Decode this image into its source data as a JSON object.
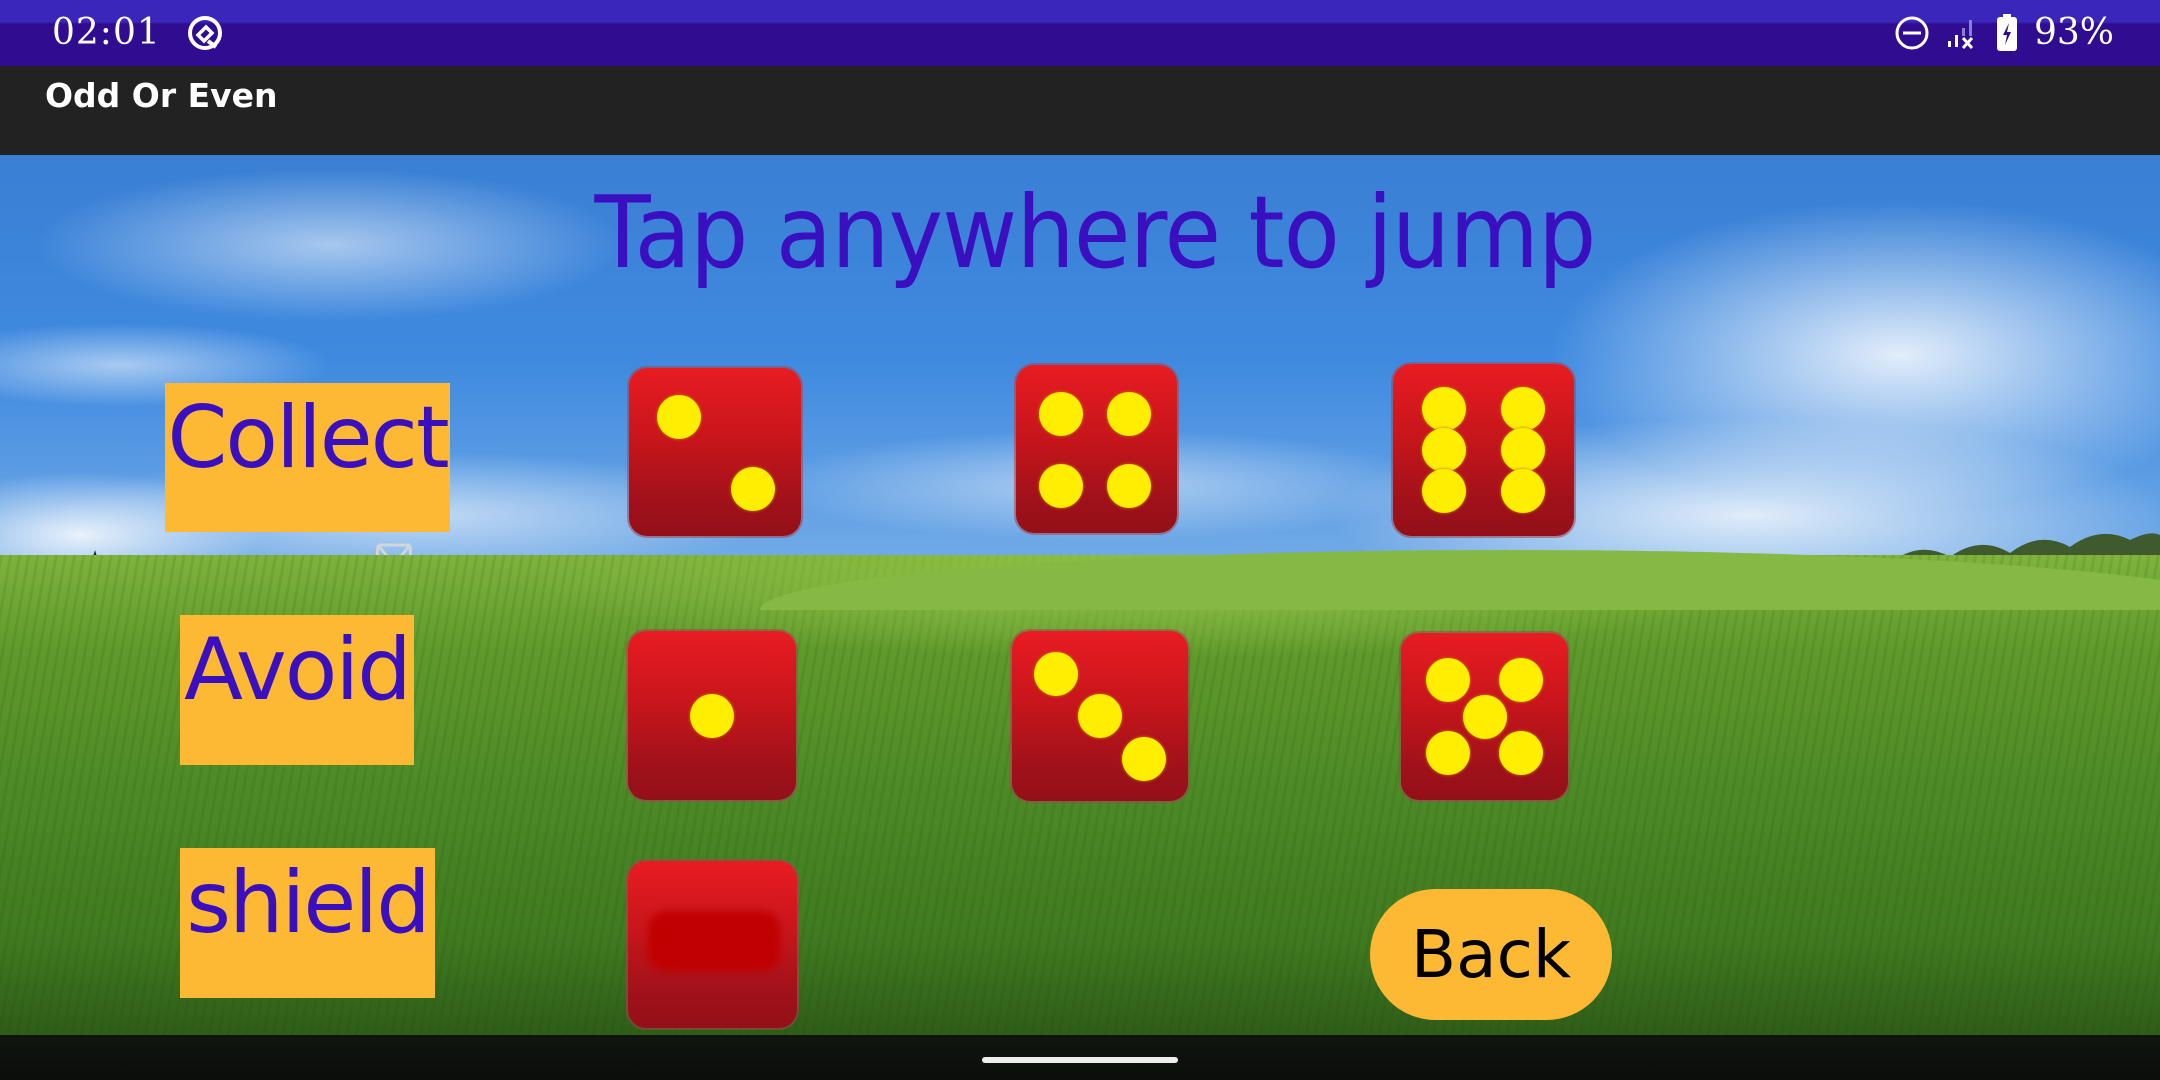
{
  "status_bar": {
    "time": "02:01",
    "app_icon": "notification-app-icon",
    "icons": [
      "do-not-disturb-icon",
      "signal-no-connection-icon",
      "battery-charging-icon"
    ],
    "battery_percent": "93%"
  },
  "app_bar": {
    "title": "Odd Or Even"
  },
  "game": {
    "instruction": "Tap anywhere to jump",
    "rows": [
      {
        "label": "Collect",
        "dice": [
          2,
          4,
          6
        ]
      },
      {
        "label": "Avoid",
        "dice": [
          1,
          3,
          5
        ]
      },
      {
        "label": "shield",
        "dice": [
          "blank"
        ]
      }
    ],
    "back_label": "Back",
    "colors": {
      "text_purple": "#3a0fbf",
      "label_bg": "#fdb933",
      "die_red": "#d4171d",
      "pip_yellow": "#ffee00",
      "status_bar": "#2f0c90",
      "app_bar": "#222222"
    }
  }
}
